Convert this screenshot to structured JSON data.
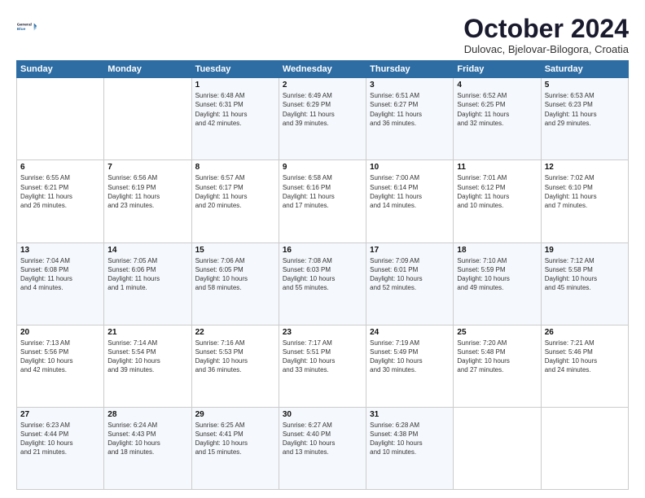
{
  "logo": {
    "line1": "General",
    "line2": "Blue"
  },
  "title": "October 2024",
  "location": "Dulovac, Bjelovar-Bilogora, Croatia",
  "days_header": [
    "Sunday",
    "Monday",
    "Tuesday",
    "Wednesday",
    "Thursday",
    "Friday",
    "Saturday"
  ],
  "weeks": [
    [
      {
        "num": "",
        "info": ""
      },
      {
        "num": "",
        "info": ""
      },
      {
        "num": "1",
        "info": "Sunrise: 6:48 AM\nSunset: 6:31 PM\nDaylight: 11 hours\nand 42 minutes."
      },
      {
        "num": "2",
        "info": "Sunrise: 6:49 AM\nSunset: 6:29 PM\nDaylight: 11 hours\nand 39 minutes."
      },
      {
        "num": "3",
        "info": "Sunrise: 6:51 AM\nSunset: 6:27 PM\nDaylight: 11 hours\nand 36 minutes."
      },
      {
        "num": "4",
        "info": "Sunrise: 6:52 AM\nSunset: 6:25 PM\nDaylight: 11 hours\nand 32 minutes."
      },
      {
        "num": "5",
        "info": "Sunrise: 6:53 AM\nSunset: 6:23 PM\nDaylight: 11 hours\nand 29 minutes."
      }
    ],
    [
      {
        "num": "6",
        "info": "Sunrise: 6:55 AM\nSunset: 6:21 PM\nDaylight: 11 hours\nand 26 minutes."
      },
      {
        "num": "7",
        "info": "Sunrise: 6:56 AM\nSunset: 6:19 PM\nDaylight: 11 hours\nand 23 minutes."
      },
      {
        "num": "8",
        "info": "Sunrise: 6:57 AM\nSunset: 6:17 PM\nDaylight: 11 hours\nand 20 minutes."
      },
      {
        "num": "9",
        "info": "Sunrise: 6:58 AM\nSunset: 6:16 PM\nDaylight: 11 hours\nand 17 minutes."
      },
      {
        "num": "10",
        "info": "Sunrise: 7:00 AM\nSunset: 6:14 PM\nDaylight: 11 hours\nand 14 minutes."
      },
      {
        "num": "11",
        "info": "Sunrise: 7:01 AM\nSunset: 6:12 PM\nDaylight: 11 hours\nand 10 minutes."
      },
      {
        "num": "12",
        "info": "Sunrise: 7:02 AM\nSunset: 6:10 PM\nDaylight: 11 hours\nand 7 minutes."
      }
    ],
    [
      {
        "num": "13",
        "info": "Sunrise: 7:04 AM\nSunset: 6:08 PM\nDaylight: 11 hours\nand 4 minutes."
      },
      {
        "num": "14",
        "info": "Sunrise: 7:05 AM\nSunset: 6:06 PM\nDaylight: 11 hours\nand 1 minute."
      },
      {
        "num": "15",
        "info": "Sunrise: 7:06 AM\nSunset: 6:05 PM\nDaylight: 10 hours\nand 58 minutes."
      },
      {
        "num": "16",
        "info": "Sunrise: 7:08 AM\nSunset: 6:03 PM\nDaylight: 10 hours\nand 55 minutes."
      },
      {
        "num": "17",
        "info": "Sunrise: 7:09 AM\nSunset: 6:01 PM\nDaylight: 10 hours\nand 52 minutes."
      },
      {
        "num": "18",
        "info": "Sunrise: 7:10 AM\nSunset: 5:59 PM\nDaylight: 10 hours\nand 49 minutes."
      },
      {
        "num": "19",
        "info": "Sunrise: 7:12 AM\nSunset: 5:58 PM\nDaylight: 10 hours\nand 45 minutes."
      }
    ],
    [
      {
        "num": "20",
        "info": "Sunrise: 7:13 AM\nSunset: 5:56 PM\nDaylight: 10 hours\nand 42 minutes."
      },
      {
        "num": "21",
        "info": "Sunrise: 7:14 AM\nSunset: 5:54 PM\nDaylight: 10 hours\nand 39 minutes."
      },
      {
        "num": "22",
        "info": "Sunrise: 7:16 AM\nSunset: 5:53 PM\nDaylight: 10 hours\nand 36 minutes."
      },
      {
        "num": "23",
        "info": "Sunrise: 7:17 AM\nSunset: 5:51 PM\nDaylight: 10 hours\nand 33 minutes."
      },
      {
        "num": "24",
        "info": "Sunrise: 7:19 AM\nSunset: 5:49 PM\nDaylight: 10 hours\nand 30 minutes."
      },
      {
        "num": "25",
        "info": "Sunrise: 7:20 AM\nSunset: 5:48 PM\nDaylight: 10 hours\nand 27 minutes."
      },
      {
        "num": "26",
        "info": "Sunrise: 7:21 AM\nSunset: 5:46 PM\nDaylight: 10 hours\nand 24 minutes."
      }
    ],
    [
      {
        "num": "27",
        "info": "Sunrise: 6:23 AM\nSunset: 4:44 PM\nDaylight: 10 hours\nand 21 minutes."
      },
      {
        "num": "28",
        "info": "Sunrise: 6:24 AM\nSunset: 4:43 PM\nDaylight: 10 hours\nand 18 minutes."
      },
      {
        "num": "29",
        "info": "Sunrise: 6:25 AM\nSunset: 4:41 PM\nDaylight: 10 hours\nand 15 minutes."
      },
      {
        "num": "30",
        "info": "Sunrise: 6:27 AM\nSunset: 4:40 PM\nDaylight: 10 hours\nand 13 minutes."
      },
      {
        "num": "31",
        "info": "Sunrise: 6:28 AM\nSunset: 4:38 PM\nDaylight: 10 hours\nand 10 minutes."
      },
      {
        "num": "",
        "info": ""
      },
      {
        "num": "",
        "info": ""
      }
    ]
  ]
}
